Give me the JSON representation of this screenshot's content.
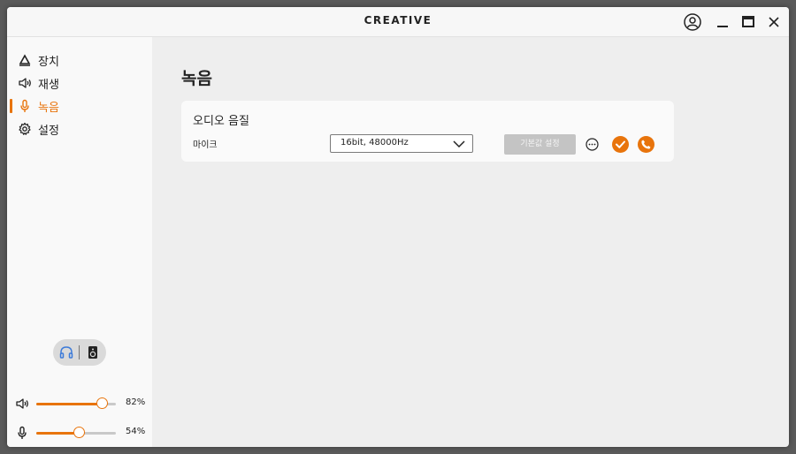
{
  "window": {
    "brand": "CREATIVE"
  },
  "sidebar": {
    "items": [
      {
        "label": "장치",
        "icon": "device-icon"
      },
      {
        "label": "재생",
        "icon": "speaker-icon"
      },
      {
        "label": "녹음",
        "icon": "microphone-icon",
        "active": true
      },
      {
        "label": "설정",
        "icon": "gear-icon"
      }
    ],
    "output_toggle": {
      "options": [
        "headphones-icon",
        "speaker-box-icon"
      ],
      "selected": "headphones-icon"
    },
    "playback_volume": {
      "value": 82,
      "label": "82%"
    },
    "recording_volume": {
      "value": 54,
      "label": "54%"
    }
  },
  "main": {
    "title": "녹음",
    "card": {
      "title": "오디오 음질",
      "row_label": "마이크",
      "format_select": {
        "selected": "16bit, 48000Hz"
      },
      "default_button": "기본값 설정"
    }
  },
  "colors": {
    "accent": "#e8740c",
    "toggle_selected": "#3d7bd9",
    "disabled_button": "#c4c4c4"
  }
}
